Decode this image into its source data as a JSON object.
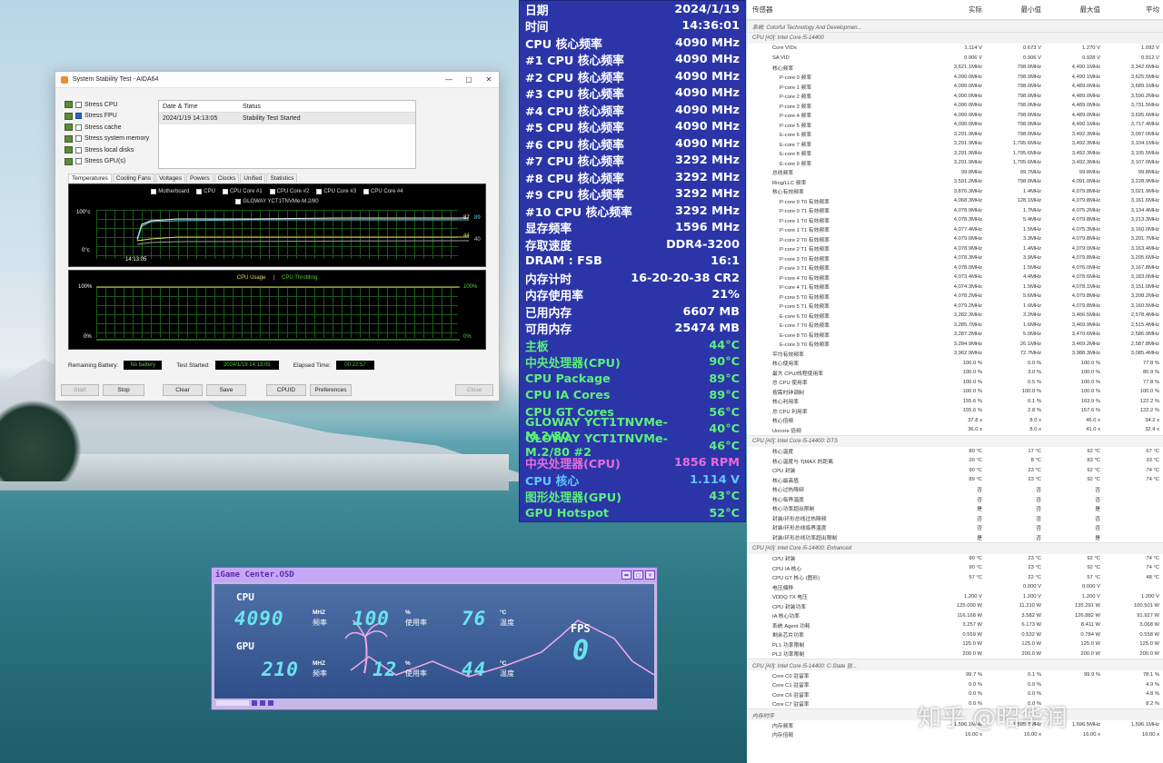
{
  "aida": {
    "title": "System Stability Test - AIDA64",
    "win_min": "—",
    "win_max": "▢",
    "win_close": "✕",
    "stress": [
      {
        "label": "Stress CPU",
        "checked": false
      },
      {
        "label": "Stress FPU",
        "checked": true
      },
      {
        "label": "Stress cache",
        "checked": false
      },
      {
        "label": "Stress system memory",
        "checked": false
      },
      {
        "label": "Stress local disks",
        "checked": false
      },
      {
        "label": "Stress GPU(s)",
        "checked": false
      }
    ],
    "log_headers": [
      "Date & Time",
      "Status"
    ],
    "log_rows": [
      [
        "2024/1/19 14:13:05",
        "Stability Test Started"
      ]
    ],
    "tabs": [
      "Temperatures",
      "Cooling Fans",
      "Voltages",
      "Powers",
      "Clocks",
      "Unified",
      "Statistics"
    ],
    "graph1_legend": [
      "Motherboard",
      "CPU",
      "CPU Core #1",
      "CPU Core #2",
      "CPU Core #3",
      "CPU Core #4"
    ],
    "graph1_legend2": "GLOWAY YCT1TNVMe-M.2/80",
    "graph1_top": "100°c",
    "graph1_bot": "0°c",
    "graph1_time": "14:13:05",
    "graph1_vals": [
      "87",
      "89",
      "44",
      "40"
    ],
    "graph2_legend_a": "CPU Usage",
    "graph2_legend_sep": "|",
    "graph2_legend_b": "CPU Throttling",
    "graph2_top": "100%",
    "graph2_bot": "0%",
    "graph2_rtop": "100%",
    "graph2_rbot": "0%",
    "battery_label": "Remaining Battery:",
    "battery_value": "No battery",
    "started_label": "Test Started:",
    "started_value": "2024/1/19 14:13:05",
    "elapsed_label": "Elapsed Time:",
    "elapsed_value": "00:22:57",
    "buttons": [
      "Start",
      "Stop",
      "Clear",
      "Save",
      "CPUID",
      "Preferences",
      "Close"
    ]
  },
  "osd": [
    {
      "l": "日期",
      "v": "2024/1/19",
      "c": "#ffffff"
    },
    {
      "l": "时间",
      "v": "14:36:01",
      "c": "#ffffff"
    },
    {
      "l": "CPU 核心频率",
      "v": "4090 MHz",
      "c": "#ffffff"
    },
    {
      "l": "#1 CPU 核心频率",
      "v": "4090 MHz",
      "c": "#ffffff"
    },
    {
      "l": "#2 CPU 核心频率",
      "v": "4090 MHz",
      "c": "#ffffff"
    },
    {
      "l": "#3 CPU 核心频率",
      "v": "4090 MHz",
      "c": "#ffffff"
    },
    {
      "l": "#4 CPU 核心频率",
      "v": "4090 MHz",
      "c": "#ffffff"
    },
    {
      "l": "#5 CPU 核心频率",
      "v": "4090 MHz",
      "c": "#ffffff"
    },
    {
      "l": "#6 CPU 核心频率",
      "v": "4090 MHz",
      "c": "#ffffff"
    },
    {
      "l": "#7 CPU 核心频率",
      "v": "3292 MHz",
      "c": "#ffffff"
    },
    {
      "l": "#8 CPU 核心频率",
      "v": "3292 MHz",
      "c": "#ffffff"
    },
    {
      "l": "#9 CPU 核心频率",
      "v": "3292 MHz",
      "c": "#ffffff"
    },
    {
      "l": "#10 CPU 核心频率",
      "v": "3292 MHz",
      "c": "#ffffff"
    },
    {
      "l": "显存频率",
      "v": "1596 MHz",
      "c": "#ffffff"
    },
    {
      "l": "存取速度",
      "v": "DDR4-3200",
      "c": "#ffffff"
    },
    {
      "l": "DRAM : FSB",
      "v": "16:1",
      "c": "#ffffff"
    },
    {
      "l": "内存计时",
      "v": "16-20-20-38 CR2",
      "c": "#ffffff"
    },
    {
      "l": "内存使用率",
      "v": "21%",
      "c": "#ffffff"
    },
    {
      "l": "已用内存",
      "v": "6607 MB",
      "c": "#ffffff"
    },
    {
      "l": "可用内存",
      "v": "25474 MB",
      "c": "#ffffff"
    },
    {
      "l": "主板",
      "v": "44°C",
      "c": "#5cf07a"
    },
    {
      "l": "中央处理器(CPU)",
      "v": "90°C",
      "c": "#5cf07a"
    },
    {
      "l": "CPU Package",
      "v": "89°C",
      "c": "#5cf07a"
    },
    {
      "l": "CPU IA Cores",
      "v": "89°C",
      "c": "#5cf07a"
    },
    {
      "l": "CPU GT Cores",
      "v": "56°C",
      "c": "#5cf07a"
    },
    {
      "l": "GLOWAY YCT1TNVMe-M.2/80",
      "v": "40°C",
      "c": "#5cf07a"
    },
    {
      "l": "GLOWAY YCT1TNVMe-M.2/80 #2",
      "v": "46°C",
      "c": "#5cf07a"
    },
    {
      "l": "中央处理器(CPU)",
      "v": "1856 RPM",
      "c": "#e86bd8"
    },
    {
      "l": "CPU 核心",
      "v": "1.114 V",
      "c": "#5ec8ff"
    },
    {
      "l": "图形处理器(GPU)",
      "v": "43°C",
      "c": "#5cf07a"
    },
    {
      "l": "GPU Hotspot",
      "v": "52°C",
      "c": "#5cf07a"
    }
  ],
  "igame": {
    "title": "iGame Center.OSD",
    "cpu_label": "CPU",
    "cpu_freq": "4090",
    "cpu_freq_unit": "MHZ",
    "cpu_freq_sub": "频率",
    "cpu_use": "100",
    "cpu_use_unit": "%",
    "cpu_use_sub": "使用率",
    "cpu_temp": "76",
    "cpu_temp_unit": "°C",
    "cpu_temp_sub": "温度",
    "gpu_label": "GPU",
    "gpu_freq": "210",
    "gpu_freq_unit": "MHZ",
    "gpu_freq_sub": "频率",
    "gpu_use": "12",
    "gpu_use_unit": "%",
    "gpu_use_sub": "使用率",
    "gpu_temp": "44",
    "gpu_temp_unit": "°C",
    "gpu_temp_sub": "温度",
    "fps_label": "FPS",
    "fps_value": "0"
  },
  "hw": {
    "headers": [
      "传感器",
      "实际",
      "最小值",
      "最大值",
      "平均"
    ],
    "sections": [
      {
        "title": "系统: Colorful Technology And Developmen...",
        "rows": []
      },
      {
        "title": "CPU [#0]: Intel Core i5-14400",
        "rows": [
          [
            "Core VIDs",
            "1.114 V",
            "0.673 V",
            "1.270 V",
            "1.092 V",
            1
          ],
          [
            "SA VID",
            "0.906 V",
            "0.906 V",
            "0.928 V",
            "0.912 V",
            1
          ],
          [
            "核心频率",
            "3,621.1MHz",
            "798.0MHz",
            "4,490.1MHz",
            "3,342.6MHz",
            1
          ],
          [
            "P-core 0 频率",
            "4,090.0MHz",
            "798.0MHz",
            "4,490.1MHz",
            "3,625.5MHz",
            2
          ],
          [
            "P-core 1 频率",
            "4,090.0MHz",
            "798.0MHz",
            "4,489.0MHz",
            "3,689.1MHz",
            2
          ],
          [
            "P-core 2 频率",
            "4,090.0MHz",
            "798.0MHz",
            "4,489.0MHz",
            "3,590.2MHz",
            2
          ],
          [
            "P-core 3 频率",
            "4,090.0MHz",
            "798.0MHz",
            "4,489.0MHz",
            "3,731.5MHz",
            2
          ],
          [
            "P-core 4 频率",
            "4,090.0MHz",
            "798.0MHz",
            "4,489.0MHz",
            "3,695.6MHz",
            2
          ],
          [
            "P-core 5 频率",
            "4,090.0MHz",
            "798.0MHz",
            "4,490.1MHz",
            "3,717.4MHz",
            2
          ],
          [
            "E-core 6 频率",
            "3,291.9MHz",
            "798.0MHz",
            "3,492.3MHz",
            "3,097.0MHz",
            2
          ],
          [
            "E-core 7 频率",
            "3,291.9MHz",
            "1,795.6MHz",
            "3,492.3MHz",
            "3,104.1MHz",
            2
          ],
          [
            "E-core 8 频率",
            "3,291.9MHz",
            "1,795.6MHz",
            "3,492.3MHz",
            "3,105.5MHz",
            2
          ],
          [
            "E-core 9 频率",
            "3,291.9MHz",
            "1,795.6MHz",
            "3,492.3MHz",
            "3,107.0MHz",
            2
          ],
          [
            "总线频率",
            "99.8MHz",
            "99.7MHz",
            "99.8MHz",
            "99.8MHz",
            1
          ],
          [
            "Ring/LLC 频率",
            "3,591.2MHz",
            "798.0MHz",
            "4,091.0MHz",
            "3,228.9MHz",
            1
          ],
          [
            "核心有效频率",
            "3,876.3MHz",
            "1.4MHz",
            "4,079.8MHz",
            "3,021.9MHz",
            1
          ],
          [
            "P-core 0 T0 有效频率",
            "4,068.3MHz",
            "128.1MHz",
            "4,079.8MHz",
            "3,161.6MHz",
            2
          ],
          [
            "P-core 0 T1 有效频率",
            "4,078.9MHz",
            "1.7MHz",
            "4,075.2MHz",
            "3,134.4MHz",
            2
          ],
          [
            "P-core 1 T0 有效频率",
            "4,078.3MHz",
            "5.4MHz",
            "4,079.8MHz",
            "3,213.3MHz",
            2
          ],
          [
            "P-core 1 T1 有效频率",
            "4,077.4MHz",
            "1.5MHz",
            "4,075.3MHz",
            "3,160.0MHz",
            2
          ],
          [
            "P-core 2 T0 有效频率",
            "4,079.0MHz",
            "3.3MHz",
            "4,079.8MHz",
            "3,201.7MHz",
            2
          ],
          [
            "P-core 2 T1 有效频率",
            "4,078.9MHz",
            "1.4MHz",
            "4,079.0MHz",
            "3,163.4MHz",
            2
          ],
          [
            "P-core 3 T0 有效频率",
            "4,078.3MHz",
            "3.9MHz",
            "4,079.8MHz",
            "3,205.6MHz",
            2
          ],
          [
            "P-core 3 T1 有效频率",
            "4,078.0MHz",
            "1.5MHz",
            "4,076.0MHz",
            "3,167.8MHz",
            2
          ],
          [
            "P-core 4 T0 有效频率",
            "4,073.4MHz",
            "4.4MHz",
            "4,078.6MHz",
            "3,183.0MHz",
            2
          ],
          [
            "P-core 4 T1 有效频率",
            "4,074.3MHz",
            "1.5MHz",
            "4,078.1MHz",
            "3,151.0MHz",
            2
          ],
          [
            "P-core 5 T0 有效频率",
            "4,078.2MHz",
            "5.6MHz",
            "4,079.8MHz",
            "3,208.2MHz",
            2
          ],
          [
            "P-core 5 T1 有效频率",
            "4,079.2MHz",
            "1.6MHz",
            "4,079.8MHz",
            "3,160.5MHz",
            2
          ],
          [
            "E-core 6 T0 有效频率",
            "3,282.3MHz",
            "3.2MHz",
            "3,466.5MHz",
            "2,578.4MHz",
            2
          ],
          [
            "E-core 7 T0 有效频率",
            "3,285.7MHz",
            "1.6MHz",
            "3,469.9MHz",
            "2,515.4MHz",
            2
          ],
          [
            "E-core 8 T0 有效频率",
            "3,287.2MHz",
            "5.0MHz",
            "3,470.6MHz",
            "2,586.9MHz",
            2
          ],
          [
            "E-core 9 T0 有效频率",
            "3,284.9MHz",
            "26.1MHz",
            "3,469.2MHz",
            "2,587.8MHz",
            2
          ],
          [
            "平均有效频率",
            "3,962.9MHz",
            "72.7MHz",
            "3,988.3MHz",
            "3,085.4MHz",
            1
          ],
          [
            "核心使用率",
            "100.0 %",
            "0.0 %",
            "100.0 %",
            "77.8 %",
            1
          ],
          [
            "最大 CPU/线程使用率",
            "100.0 %",
            "3.0 %",
            "100.0 %",
            "80.9 %",
            1
          ],
          [
            "总 CPU 使用率",
            "100.0 %",
            "0.5 %",
            "100.0 %",
            "77.8 %",
            1
          ],
          [
            "按需时钟调制",
            "100.0 %",
            "100.0 %",
            "100.0 %",
            "100.0 %",
            1
          ],
          [
            "核心利用率",
            "155.6 %",
            "0.1 %",
            "163.9 %",
            "122.2 %",
            1
          ],
          [
            "总 CPU 利用率",
            "155.6 %",
            "2.8 %",
            "157.6 %",
            "122.2 %",
            1
          ],
          [
            "核心倍频",
            "37.8 x",
            "8.0 x",
            "45.0 x",
            "34.2 x",
            1
          ],
          [
            "Uncore 倍频",
            "36.0 x",
            "8.0 x",
            "41.0 x",
            "32.4 x",
            1
          ]
        ]
      },
      {
        "title": "CPU [#0]: Intel Core i5-14400: DTS",
        "rows": [
          [
            "核心温度",
            "80 °C",
            "17 °C",
            "92 °C",
            "67 °C",
            1
          ],
          [
            "核心温度与 TjMAX 的距离",
            "20 °C",
            "8 °C",
            "83 °C",
            "33 °C",
            1
          ],
          [
            "CPU 封装",
            "90 °C",
            "23 °C",
            "92 °C",
            "74 °C",
            1
          ],
          [
            "核心最高值",
            "89 °C",
            "23 °C",
            "92 °C",
            "74 °C",
            1
          ],
          [
            "核心过热降频",
            "否",
            "否",
            "否",
            "",
            1
          ],
          [
            "核心临界温度",
            "否",
            "否",
            "否",
            "",
            1
          ],
          [
            "核心功率超出限制",
            "是",
            "否",
            "是",
            "",
            1
          ],
          [
            "封装/环形总线过热降频",
            "否",
            "否",
            "否",
            "",
            1
          ],
          [
            "封装/环形总线临界温度",
            "否",
            "否",
            "否",
            "",
            1
          ],
          [
            "封装/环形总线功率超出限制",
            "是",
            "否",
            "是",
            "",
            1
          ]
        ]
      },
      {
        "title": "CPU [#0]: Intel Core i5-14400: Enhanced",
        "rows": [
          [
            "CPU 封装",
            "90 °C",
            "23 °C",
            "92 °C",
            "74 °C",
            1
          ],
          [
            "CPU IA 核心",
            "90 °C",
            "23 °C",
            "92 °C",
            "74 °C",
            1
          ],
          [
            "CPU GT 核心 (图形)",
            "57 °C",
            "22 °C",
            "57 °C",
            "48 °C",
            1
          ],
          [
            "电压偏移",
            "",
            "0.000 V",
            "0.000 V",
            "",
            1
          ],
          [
            "VDDQ TX 电压",
            "1.200 V",
            "1.200 V",
            "1.200 V",
            "1.200 V",
            1
          ],
          [
            "CPU 封装功率",
            "125.000 W",
            "11.210 W",
            "135.291 W",
            "100.501 W",
            1
          ],
          [
            "IA 核心功率",
            "116.168 W",
            "3.582 W",
            "126.882 W",
            "91.927 W",
            1
          ],
          [
            "系统 Agent 功耗",
            "3.257 W",
            "6.173 W",
            "8.411 W",
            "3.068 W",
            1
          ],
          [
            "剩余芯片功率",
            "0.559 W",
            "0.532 W",
            "0.784 W",
            "0.558 W",
            1
          ],
          [
            "PL1 功率限制",
            "125.0 W",
            "125.0 W",
            "125.0 W",
            "125.0 W",
            1
          ],
          [
            "PL2 功率限制",
            "200.0 W",
            "200.0 W",
            "200.0 W",
            "200.0 W",
            1
          ]
        ]
      },
      {
        "title": "CPU [#0]: Intel Core i5-14400: C-State 驻...",
        "rows": [
          [
            "Core C0 驻留率",
            "99.7 %",
            "0.1 %",
            "99.9 %",
            "78.1 %",
            1
          ],
          [
            "Core C1 驻留率",
            "0.0 %",
            "0.0 %",
            "",
            "4.9 %",
            1
          ],
          [
            "Core C6 驻留率",
            "0.0 %",
            "0.0 %",
            "",
            "4.8 %",
            1
          ],
          [
            "Core C7 驻留率",
            "0.0 %",
            "0.0 %",
            "",
            "8.2 %",
            1
          ]
        ]
      },
      {
        "title": "内存时序",
        "rows": [
          [
            "内存频率",
            "1,596.1MHz",
            "1,595.7MHz",
            "1,596.5MHz",
            "1,596.1MHz",
            1
          ],
          [
            "内存倍频",
            "16.00 x",
            "16.00 x",
            "16.00 x",
            "16.00 x",
            1
          ]
        ]
      }
    ]
  },
  "watermark": "知乎 @昭华润"
}
